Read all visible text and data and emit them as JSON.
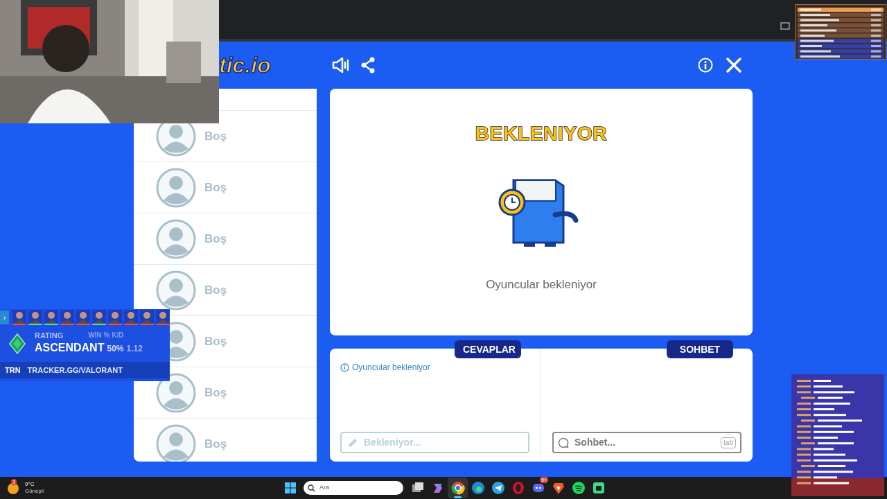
{
  "game": {
    "logo": "tic.io",
    "title": "BEKLENIYOR",
    "status": "Oyuncular bekleniyor",
    "players": [
      {
        "name": "Boş"
      },
      {
        "name": "Boş"
      },
      {
        "name": "Boş"
      },
      {
        "name": "Boş"
      },
      {
        "name": "Boş"
      },
      {
        "name": "Boş"
      },
      {
        "name": "Boş"
      }
    ],
    "tabs": [
      {
        "label": "CEVAPLAR"
      },
      {
        "label": "SOHBET"
      }
    ],
    "answers": {
      "notice": "Oyuncular bekleniyor",
      "placeholder": "Bekleniyor..."
    },
    "chat": {
      "placeholder": "Sohbet...",
      "key_hint": "tab"
    }
  },
  "tracker_overlay": {
    "toggle": "›",
    "agents": [
      {
        "color": "#e84a5f"
      },
      {
        "color": "#3ee0c0"
      },
      {
        "color": "#3ee0c0"
      },
      {
        "color": "#e84a5f"
      },
      {
        "color": "#e84a5f"
      },
      {
        "color": "#3ee0c0"
      },
      {
        "color": "#e84a5f"
      },
      {
        "color": "#e84a5f"
      },
      {
        "color": "#e84a5f"
      },
      {
        "color": "#e84a5f"
      }
    ],
    "rating_label": "RATING",
    "rank": "ASCENDANT",
    "stats_label": "WIN % K/D",
    "win_rate": "50%",
    "kd": "1.12",
    "brand": "TRN",
    "url": "TRACKER.GG/VALORANT"
  },
  "taskbar": {
    "weather": {
      "badge": "3",
      "temp": "9°C",
      "condition": "Güneşli"
    },
    "search": {
      "placeholder": "Ara"
    },
    "apps": [
      {
        "kind": "taskview",
        "selected": false
      },
      {
        "kind": "copilot",
        "selected": false
      },
      {
        "kind": "chrome",
        "selected": true
      },
      {
        "kind": "edge",
        "selected": false
      },
      {
        "kind": "telegram",
        "selected": false
      },
      {
        "kind": "opera",
        "selected": false
      },
      {
        "kind": "discord",
        "selected": false,
        "badge": "9+"
      },
      {
        "kind": "brave",
        "selected": false
      },
      {
        "kind": "spotify",
        "selected": false
      },
      {
        "kind": "app",
        "selected": false
      }
    ]
  }
}
